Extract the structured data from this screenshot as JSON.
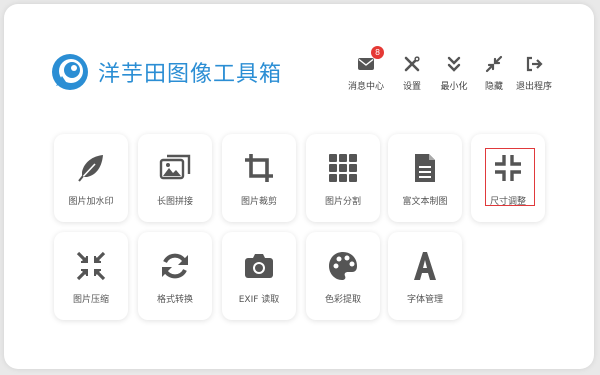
{
  "app": {
    "title": "洋芋田图像工具箱"
  },
  "toolbar": {
    "messages": {
      "label": "消息中心",
      "badge": "8",
      "icon": "envelope-icon"
    },
    "settings": {
      "label": "设置",
      "icon": "tools-icon"
    },
    "minimize": {
      "label": "最小化",
      "icon": "chevrons-down-icon"
    },
    "hide": {
      "label": "隐藏",
      "icon": "compress-icon"
    },
    "exit": {
      "label": "退出程序",
      "icon": "sign-out-icon"
    }
  },
  "tools": [
    {
      "label": "图片加水印",
      "icon": "feather-icon"
    },
    {
      "label": "长图拼接",
      "icon": "images-icon"
    },
    {
      "label": "图片裁剪",
      "icon": "crop-icon"
    },
    {
      "label": "图片分割",
      "icon": "grid-icon"
    },
    {
      "label": "富文本制图",
      "icon": "document-icon"
    },
    {
      "label": "尺寸调整",
      "icon": "resize-icon",
      "selected": true
    },
    {
      "label": "图片压缩",
      "icon": "compress-arrows-icon"
    },
    {
      "label": "格式转换",
      "icon": "sync-icon"
    },
    {
      "label": "EXIF 读取",
      "icon": "camera-icon"
    },
    {
      "label": "色彩提取",
      "icon": "palette-icon"
    },
    {
      "label": "字体管理",
      "icon": "font-icon"
    }
  ],
  "colors": {
    "accent": "#2b8ed4",
    "icon": "#555555",
    "badge": "#e53935",
    "selection": "#e0393b"
  }
}
